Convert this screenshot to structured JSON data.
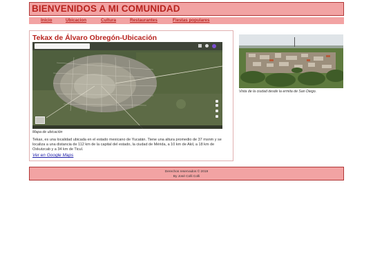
{
  "header": {
    "title": "BIENVENIDOS A MI COMUNIDAD"
  },
  "nav": {
    "items": [
      {
        "label": "Inicio"
      },
      {
        "label": "Ubicacion"
      },
      {
        "label": "Cultura"
      },
      {
        "label": "Restaurantes"
      },
      {
        "label": "Fiestas populares"
      }
    ]
  },
  "main": {
    "title": "Tekax de Álvaro Obregón-Ubicación",
    "map_caption": "Mapa de ubicación",
    "description": "Tekax, es una localidad ubicada en el estado mexicano de Yucatán. Tiene una altura promedio de 37 msnm y se localiza a una distancia de 112 km de la capital del estado, la ciudad de Mérida, a 10 km de Akil, a 18 km de Oxkutzcab y a 34 km de Ticul.",
    "maps_link": "Ver en Google Maps"
  },
  "aside": {
    "photo_caption": "Vista de la ciudad desde la ermita de San Diego."
  },
  "footer": {
    "copyright": "Derechos reservados © 2019",
    "author": "By José Colli Colli"
  },
  "colors": {
    "accent": "#b8241f",
    "banner": "#f2a3a3",
    "link": "#1a1aa6"
  }
}
